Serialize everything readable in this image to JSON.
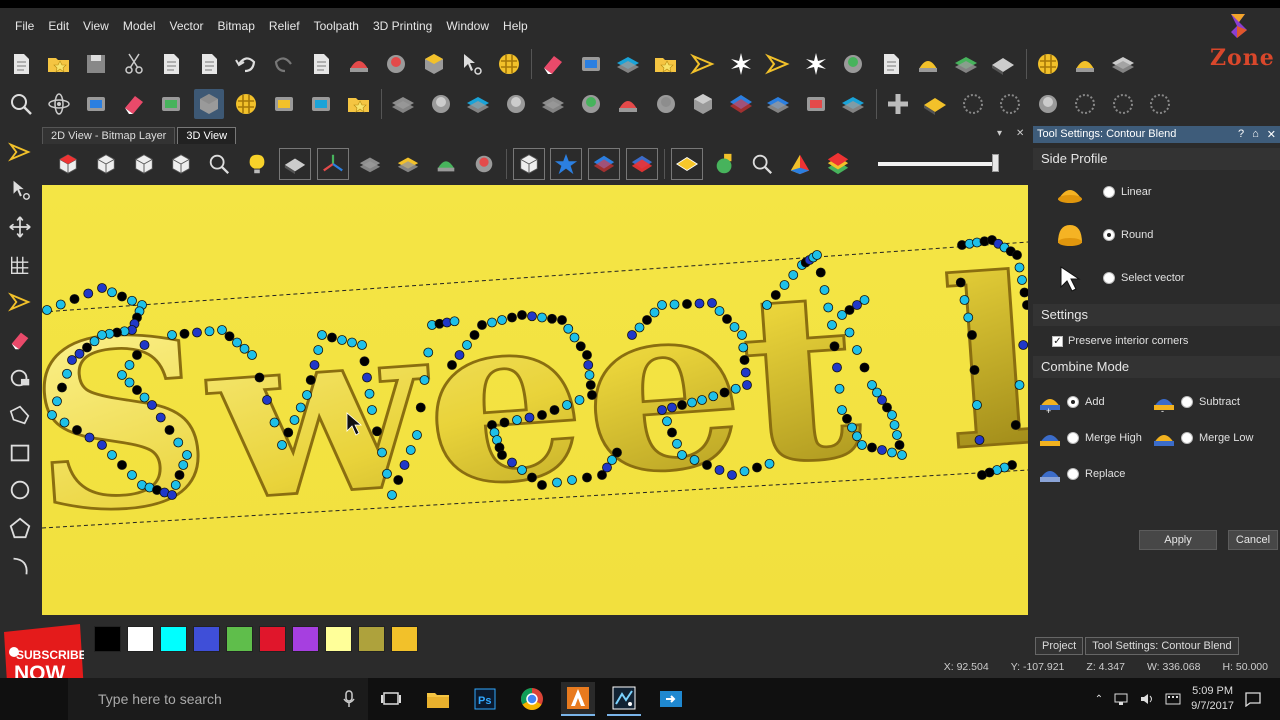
{
  "menu": [
    "File",
    "Edit",
    "View",
    "Model",
    "Vector",
    "Bitmap",
    "Relief",
    "Toolpath",
    "3D Printing",
    "Window",
    "Help"
  ],
  "brand": {
    "text": "Zone"
  },
  "toolbar1_icons": [
    "new-file-icon",
    "open-folder-icon",
    "save-icon",
    "cut-icon",
    "copy-icon",
    "paste-icon",
    "undo-icon",
    "redo-icon",
    "notes-icon",
    "align-icon",
    "group-icon",
    "grid-icon",
    "node-edit-icon",
    "pattern-icon",
    "sep",
    "eraser-relief-icon",
    "relief-layer-icon",
    "relief-stack-icon",
    "open-star-folder-icon",
    "arrow-vector-icon",
    "vector-sparkle-icon",
    "pen-curve-icon",
    "star-burst-icon",
    "relief-dome-icon",
    "relief-copy-icon",
    "relief-frame-icon",
    "relief-grid-icon",
    "relief-plane-icon",
    "sep",
    "weave-icon",
    "wave-icon",
    "loop-icon"
  ],
  "toolbar2_icons": [
    "zoom-icon",
    "atom-icon",
    "extrude-icon",
    "eraser-icon",
    "layer-up-icon",
    "contour-blend-icon",
    "weave-grid-icon",
    "dome-icon",
    "relief-flat-icon",
    "star-folder-icon",
    "sep",
    "relief-diamond-icon",
    "relief-cube-icon",
    "relief-stack-icon",
    "relief-lift-icon",
    "relief-ring-icon",
    "relief-cone-icon",
    "relief-pin-icon",
    "relief-slope-icon",
    "relief-merge-icon",
    "relief-blue-icon",
    "relief-bowl-icon",
    "relief-gem-icon",
    "relief-layers-icon",
    "sep",
    "add-relief-icon",
    "relief-knob-icon",
    "ring-dotted-icon",
    "arc-dotted-icon",
    "corner-icon",
    "square-dotted-icon",
    "frame-dotted-icon",
    "curve-dotted-icon"
  ],
  "tabs": [
    {
      "label": "2D View - Bitmap Layer"
    },
    {
      "label": "3D View"
    }
  ],
  "view_tab_controls": {
    "dropdown": "▾",
    "close": "✕"
  },
  "view_toolbar_icons": [
    "iso-view-icon",
    "top-view-icon",
    "front-view-icon",
    "right-view-icon",
    "zoom-view-icon",
    "light-icon",
    "relief-plane-icon",
    "axis-icon",
    "puzzle-icon",
    "cylinder-icon",
    "relief-box-icon",
    "gear-box-icon",
    "sep",
    "fit-view-icon",
    "star-relief-icon",
    "layer-blue-icon",
    "layer-red-icon",
    "sep",
    "gold-plane-icon",
    "shapes-icon",
    "zoom-star-icon",
    "pyramid-icon",
    "color-layers-icon"
  ],
  "left_tools": [
    "select-arrow-icon",
    "node-edit-icon",
    "transform-icon",
    "dimension-icon",
    "pencil-icon",
    "eraser-icon",
    "spin-tool-icon",
    "polyline-icon",
    "rectangle-icon",
    "circle-icon",
    "polygon-icon",
    "arc-icon"
  ],
  "panel": {
    "title": "Tool Settings: Contour Blend",
    "title_ctrls": [
      "?",
      "⌂",
      "✕"
    ],
    "side_profile": {
      "heading": "Side Profile",
      "options": [
        {
          "label": "Linear",
          "selected": false
        },
        {
          "label": "Round",
          "selected": true
        },
        {
          "label": "Select vector",
          "selected": false
        }
      ]
    },
    "settings": {
      "heading": "Settings",
      "preserve_label": "Preserve interior corners",
      "preserve_checked": true,
      "check_mark": "✓"
    },
    "combine": {
      "heading": "Combine Mode",
      "options": [
        {
          "label": "Add",
          "selected": true
        },
        {
          "label": "Subtract",
          "selected": false
        },
        {
          "label": "Merge High",
          "selected": false
        },
        {
          "label": "Merge Low",
          "selected": false
        },
        {
          "label": "Replace",
          "selected": false
        }
      ]
    },
    "apply": "Apply",
    "cancel": "Cancel"
  },
  "palette": [
    "#000000",
    "#ffffff",
    "#00ffff",
    "#3f4fd8",
    "#5fbe4b",
    "#e0162b",
    "#a63fe0",
    "#ffff99",
    "#aea23c",
    "#f2c12a"
  ],
  "viewport_text": "Sweet l",
  "subscribe": {
    "line1": "SUBSCRIBE",
    "line2": "NOW"
  },
  "bottom_tabs": [
    "Project",
    "Tool Settings: Contour Blend"
  ],
  "status": {
    "x": "X: 92.504",
    "y": "Y: -107.921",
    "z": "Z: 4.347",
    "w": "W: 336.068",
    "h": "H: 50.000"
  },
  "taskbar": {
    "search_placeholder": "Type here to search",
    "time": "5:09 PM",
    "date": "9/7/2017"
  }
}
